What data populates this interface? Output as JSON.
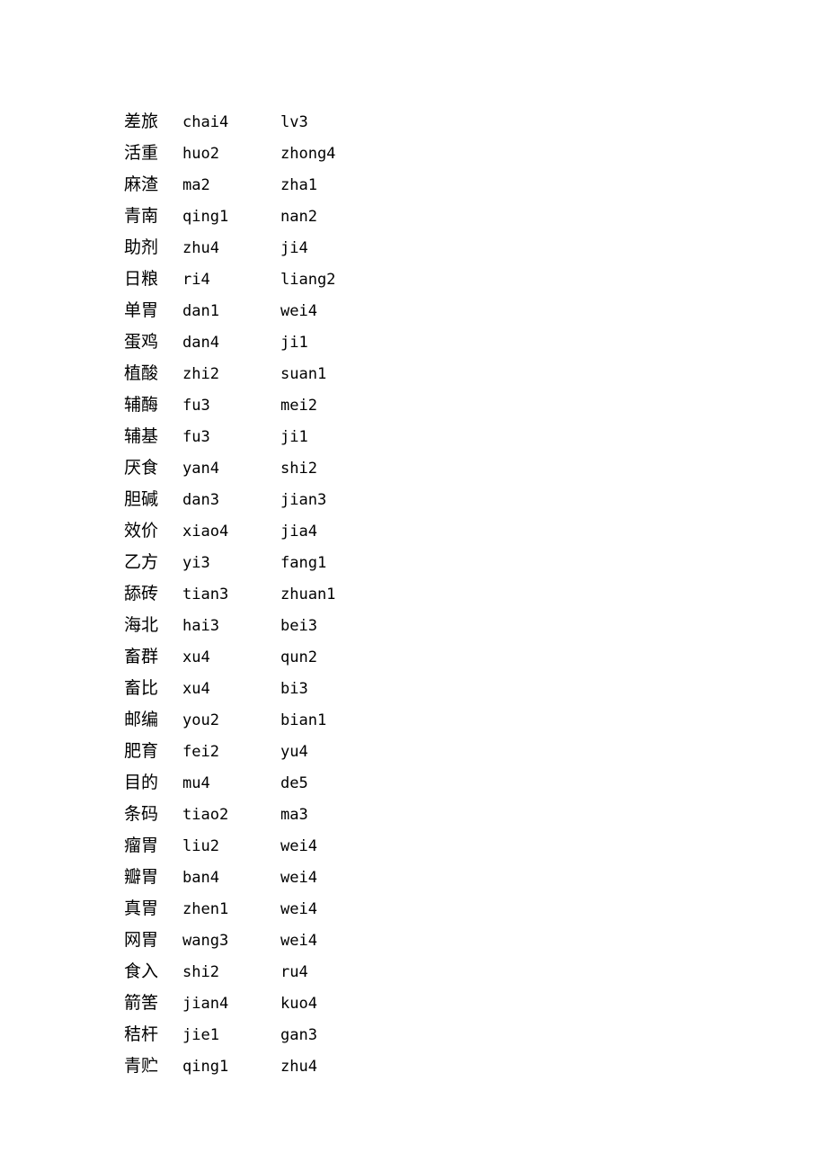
{
  "document": {
    "background_color": "#ffffff",
    "text_color": "#000000",
    "columns": {
      "term": "term",
      "pinyin_first": "pinyin_first",
      "pinyin_second": "pinyin_second"
    },
    "rows": [
      {
        "term": "差旅",
        "pinyin_first": "chai4",
        "pinyin_second": "lv3"
      },
      {
        "term": "活重",
        "pinyin_first": "huo2",
        "pinyin_second": "zhong4"
      },
      {
        "term": "麻渣",
        "pinyin_first": "ma2",
        "pinyin_second": "zha1"
      },
      {
        "term": "青南",
        "pinyin_first": "qing1",
        "pinyin_second": "nan2"
      },
      {
        "term": "助剂",
        "pinyin_first": "zhu4",
        "pinyin_second": "ji4"
      },
      {
        "term": "日粮",
        "pinyin_first": "ri4",
        "pinyin_second": "liang2"
      },
      {
        "term": "单胃",
        "pinyin_first": "dan1",
        "pinyin_second": "wei4"
      },
      {
        "term": "蛋鸡",
        "pinyin_first": "dan4",
        "pinyin_second": "ji1"
      },
      {
        "term": "植酸",
        "pinyin_first": "zhi2",
        "pinyin_second": "suan1"
      },
      {
        "term": "辅酶",
        "pinyin_first": "fu3",
        "pinyin_second": "mei2"
      },
      {
        "term": "辅基",
        "pinyin_first": "fu3",
        "pinyin_second": "ji1"
      },
      {
        "term": "厌食",
        "pinyin_first": "yan4",
        "pinyin_second": "shi2"
      },
      {
        "term": "胆碱",
        "pinyin_first": "dan3",
        "pinyin_second": "jian3"
      },
      {
        "term": "效价",
        "pinyin_first": "xiao4",
        "pinyin_second": "jia4"
      },
      {
        "term": "乙方",
        "pinyin_first": "yi3",
        "pinyin_second": "fang1"
      },
      {
        "term": "舔砖",
        "pinyin_first": "tian3",
        "pinyin_second": "zhuan1"
      },
      {
        "term": "海北",
        "pinyin_first": "hai3",
        "pinyin_second": "bei3"
      },
      {
        "term": "畜群",
        "pinyin_first": "xu4",
        "pinyin_second": "qun2"
      },
      {
        "term": "畜比",
        "pinyin_first": "xu4",
        "pinyin_second": "bi3"
      },
      {
        "term": "邮编",
        "pinyin_first": "you2",
        "pinyin_second": "bian1"
      },
      {
        "term": "肥育",
        "pinyin_first": "fei2",
        "pinyin_second": "yu4"
      },
      {
        "term": "目的",
        "pinyin_first": "mu4",
        "pinyin_second": "de5"
      },
      {
        "term": "条码",
        "pinyin_first": "tiao2",
        "pinyin_second": "ma3"
      },
      {
        "term": "瘤胃",
        "pinyin_first": "liu2",
        "pinyin_second": "wei4"
      },
      {
        "term": "瓣胃",
        "pinyin_first": "ban4",
        "pinyin_second": "wei4"
      },
      {
        "term": "真胃",
        "pinyin_first": "zhen1",
        "pinyin_second": "wei4"
      },
      {
        "term": "网胃",
        "pinyin_first": "wang3",
        "pinyin_second": "wei4"
      },
      {
        "term": "食入",
        "pinyin_first": "shi2",
        "pinyin_second": "ru4"
      },
      {
        "term": "箭筈",
        "pinyin_first": "jian4",
        "pinyin_second": "kuo4"
      },
      {
        "term": "秸杆",
        "pinyin_first": "jie1",
        "pinyin_second": "gan3"
      },
      {
        "term": "青贮",
        "pinyin_first": "qing1",
        "pinyin_second": "zhu4"
      }
    ]
  }
}
